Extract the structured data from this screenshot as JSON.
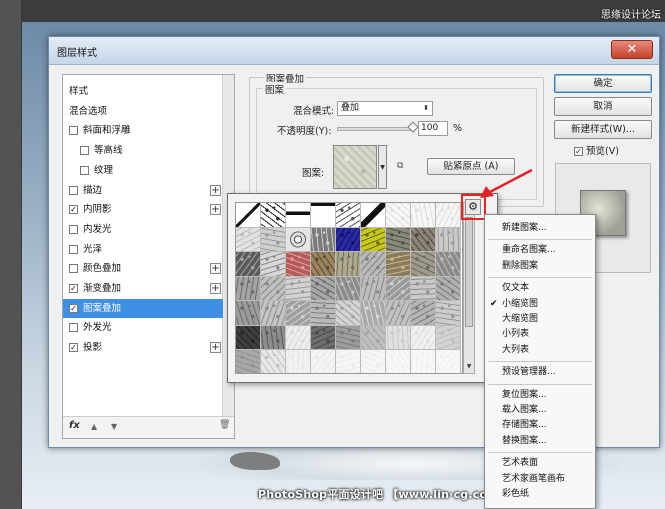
{
  "background": {
    "top_watermark": "思缘设计论坛",
    "bottom_watermark": "PhotoShop平面设计吧 【www.lin·cg.com/tieba/1783】"
  },
  "dialog": {
    "title": "图层样式",
    "close_symbol": "✕"
  },
  "style_list": {
    "items": [
      {
        "label": "样式",
        "checkbox": false,
        "checked": false,
        "indent": 0,
        "plus": false,
        "selected": false
      },
      {
        "label": "混合选项",
        "checkbox": false,
        "checked": false,
        "indent": 0,
        "plus": false,
        "selected": false
      },
      {
        "label": "斜面和浮雕",
        "checkbox": true,
        "checked": false,
        "indent": 0,
        "plus": false,
        "selected": false
      },
      {
        "label": "等高线",
        "checkbox": true,
        "checked": false,
        "indent": 1,
        "plus": false,
        "selected": false
      },
      {
        "label": "纹理",
        "checkbox": true,
        "checked": false,
        "indent": 1,
        "plus": false,
        "selected": false
      },
      {
        "label": "描边",
        "checkbox": true,
        "checked": false,
        "indent": 0,
        "plus": true,
        "selected": false
      },
      {
        "label": "内阴影",
        "checkbox": true,
        "checked": true,
        "indent": 0,
        "plus": true,
        "selected": false
      },
      {
        "label": "内发光",
        "checkbox": true,
        "checked": false,
        "indent": 0,
        "plus": false,
        "selected": false
      },
      {
        "label": "光泽",
        "checkbox": true,
        "checked": false,
        "indent": 0,
        "plus": false,
        "selected": false
      },
      {
        "label": "颜色叠加",
        "checkbox": true,
        "checked": false,
        "indent": 0,
        "plus": true,
        "selected": false
      },
      {
        "label": "渐变叠加",
        "checkbox": true,
        "checked": true,
        "indent": 0,
        "plus": true,
        "selected": false
      },
      {
        "label": "图案叠加",
        "checkbox": true,
        "checked": true,
        "indent": 0,
        "plus": false,
        "selected": true
      },
      {
        "label": "外发光",
        "checkbox": true,
        "checked": false,
        "indent": 0,
        "plus": false,
        "selected": false
      },
      {
        "label": "投影",
        "checkbox": true,
        "checked": true,
        "indent": 0,
        "plus": true,
        "selected": false
      }
    ],
    "plus_symbol": "+",
    "check_symbol": "✓",
    "footer": {
      "fx": "fx",
      "up": "▲",
      "down": "▼",
      "trash": "🗑"
    }
  },
  "pattern_overlay": {
    "group_title": "图案叠加",
    "subgroup_title": "图案",
    "blend_mode_label": "混合模式:",
    "blend_mode_value": "叠加",
    "opacity_label": "不透明度(Y):",
    "opacity_value": "100",
    "opacity_unit": "%",
    "opacity_fraction": 1.0,
    "pattern_label": "图案:",
    "snap_origin_label": "贴紧原点 (A)"
  },
  "buttons": {
    "ok": "确定",
    "cancel": "取消",
    "new_style": "新建样式(W)...",
    "preview_label": "预览(V)",
    "preview_checked": true
  },
  "picker": {
    "gear_symbol": "⚙",
    "scroll_up": "▲",
    "scroll_down": "▼"
  },
  "menu": {
    "items": [
      {
        "label": "新建图案...",
        "checked": false
      },
      {
        "sep": true
      },
      {
        "label": "重命名图案...",
        "checked": false
      },
      {
        "label": "删除图案",
        "checked": false
      },
      {
        "sep": true
      },
      {
        "label": "仅文本",
        "checked": false
      },
      {
        "label": "小缩览图",
        "checked": true
      },
      {
        "label": "大缩览图",
        "checked": false
      },
      {
        "label": "小列表",
        "checked": false
      },
      {
        "label": "大列表",
        "checked": false
      },
      {
        "sep": true
      },
      {
        "label": "预设管理器...",
        "checked": false
      },
      {
        "sep": true
      },
      {
        "label": "复位图案...",
        "checked": false
      },
      {
        "label": "载入图案...",
        "checked": false
      },
      {
        "label": "存储图案...",
        "checked": false
      },
      {
        "label": "替换图案...",
        "checked": false
      },
      {
        "sep": true
      },
      {
        "label": "艺术表面",
        "checked": false
      },
      {
        "label": "艺术家画笔画布",
        "checked": false
      },
      {
        "label": "彩色纸",
        "checked": false
      }
    ],
    "check_symbol": "✔"
  },
  "colors": {
    "selection_blue": "#3e90e4",
    "close_red": "#c7412b",
    "annotation_red": "#e22222"
  }
}
